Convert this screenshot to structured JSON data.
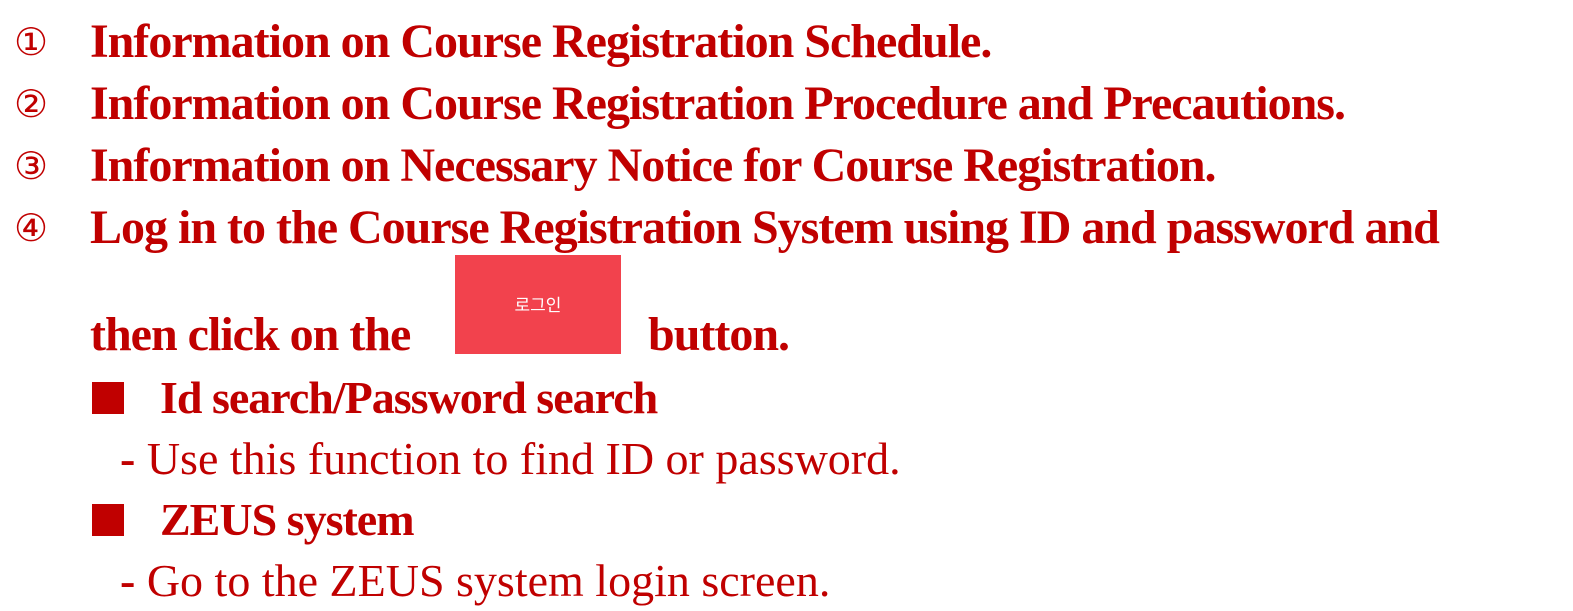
{
  "steps": [
    {
      "marker": "①",
      "text": "Information on Course Registration Schedule."
    },
    {
      "marker": "②",
      "text": "Information on Course Registration Procedure and Precautions."
    },
    {
      "marker": "③",
      "text": "Information on Necessary Notice for Course Registration."
    },
    {
      "marker": "④",
      "text": "Log in to the Course Registration System using ID and password and"
    }
  ],
  "step4_continuation": {
    "before": "then click on the",
    "button_label": "로그인",
    "after": "button."
  },
  "sections": [
    {
      "title": "Id search/Password search",
      "dash": "-",
      "description": "Use this function to find ID or password."
    },
    {
      "title": "ZEUS system",
      "dash": "-",
      "description": "Go to the ZEUS system login screen."
    }
  ],
  "colors": {
    "text": "#c00000",
    "login_button": "#f2424d",
    "background": "#ffffff"
  }
}
